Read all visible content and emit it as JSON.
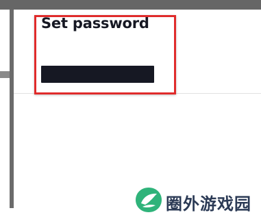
{
  "form": {
    "title": "Set password",
    "password_value": ""
  },
  "watermark": {
    "text": "圈外游戏园",
    "logo_icon": "leaf-logo-icon",
    "logo_color": "#2fb37a",
    "text_color": "#2b3a55"
  },
  "colors": {
    "highlight": "#e02b2b",
    "field_fill": "#161823",
    "title": "#161823"
  }
}
